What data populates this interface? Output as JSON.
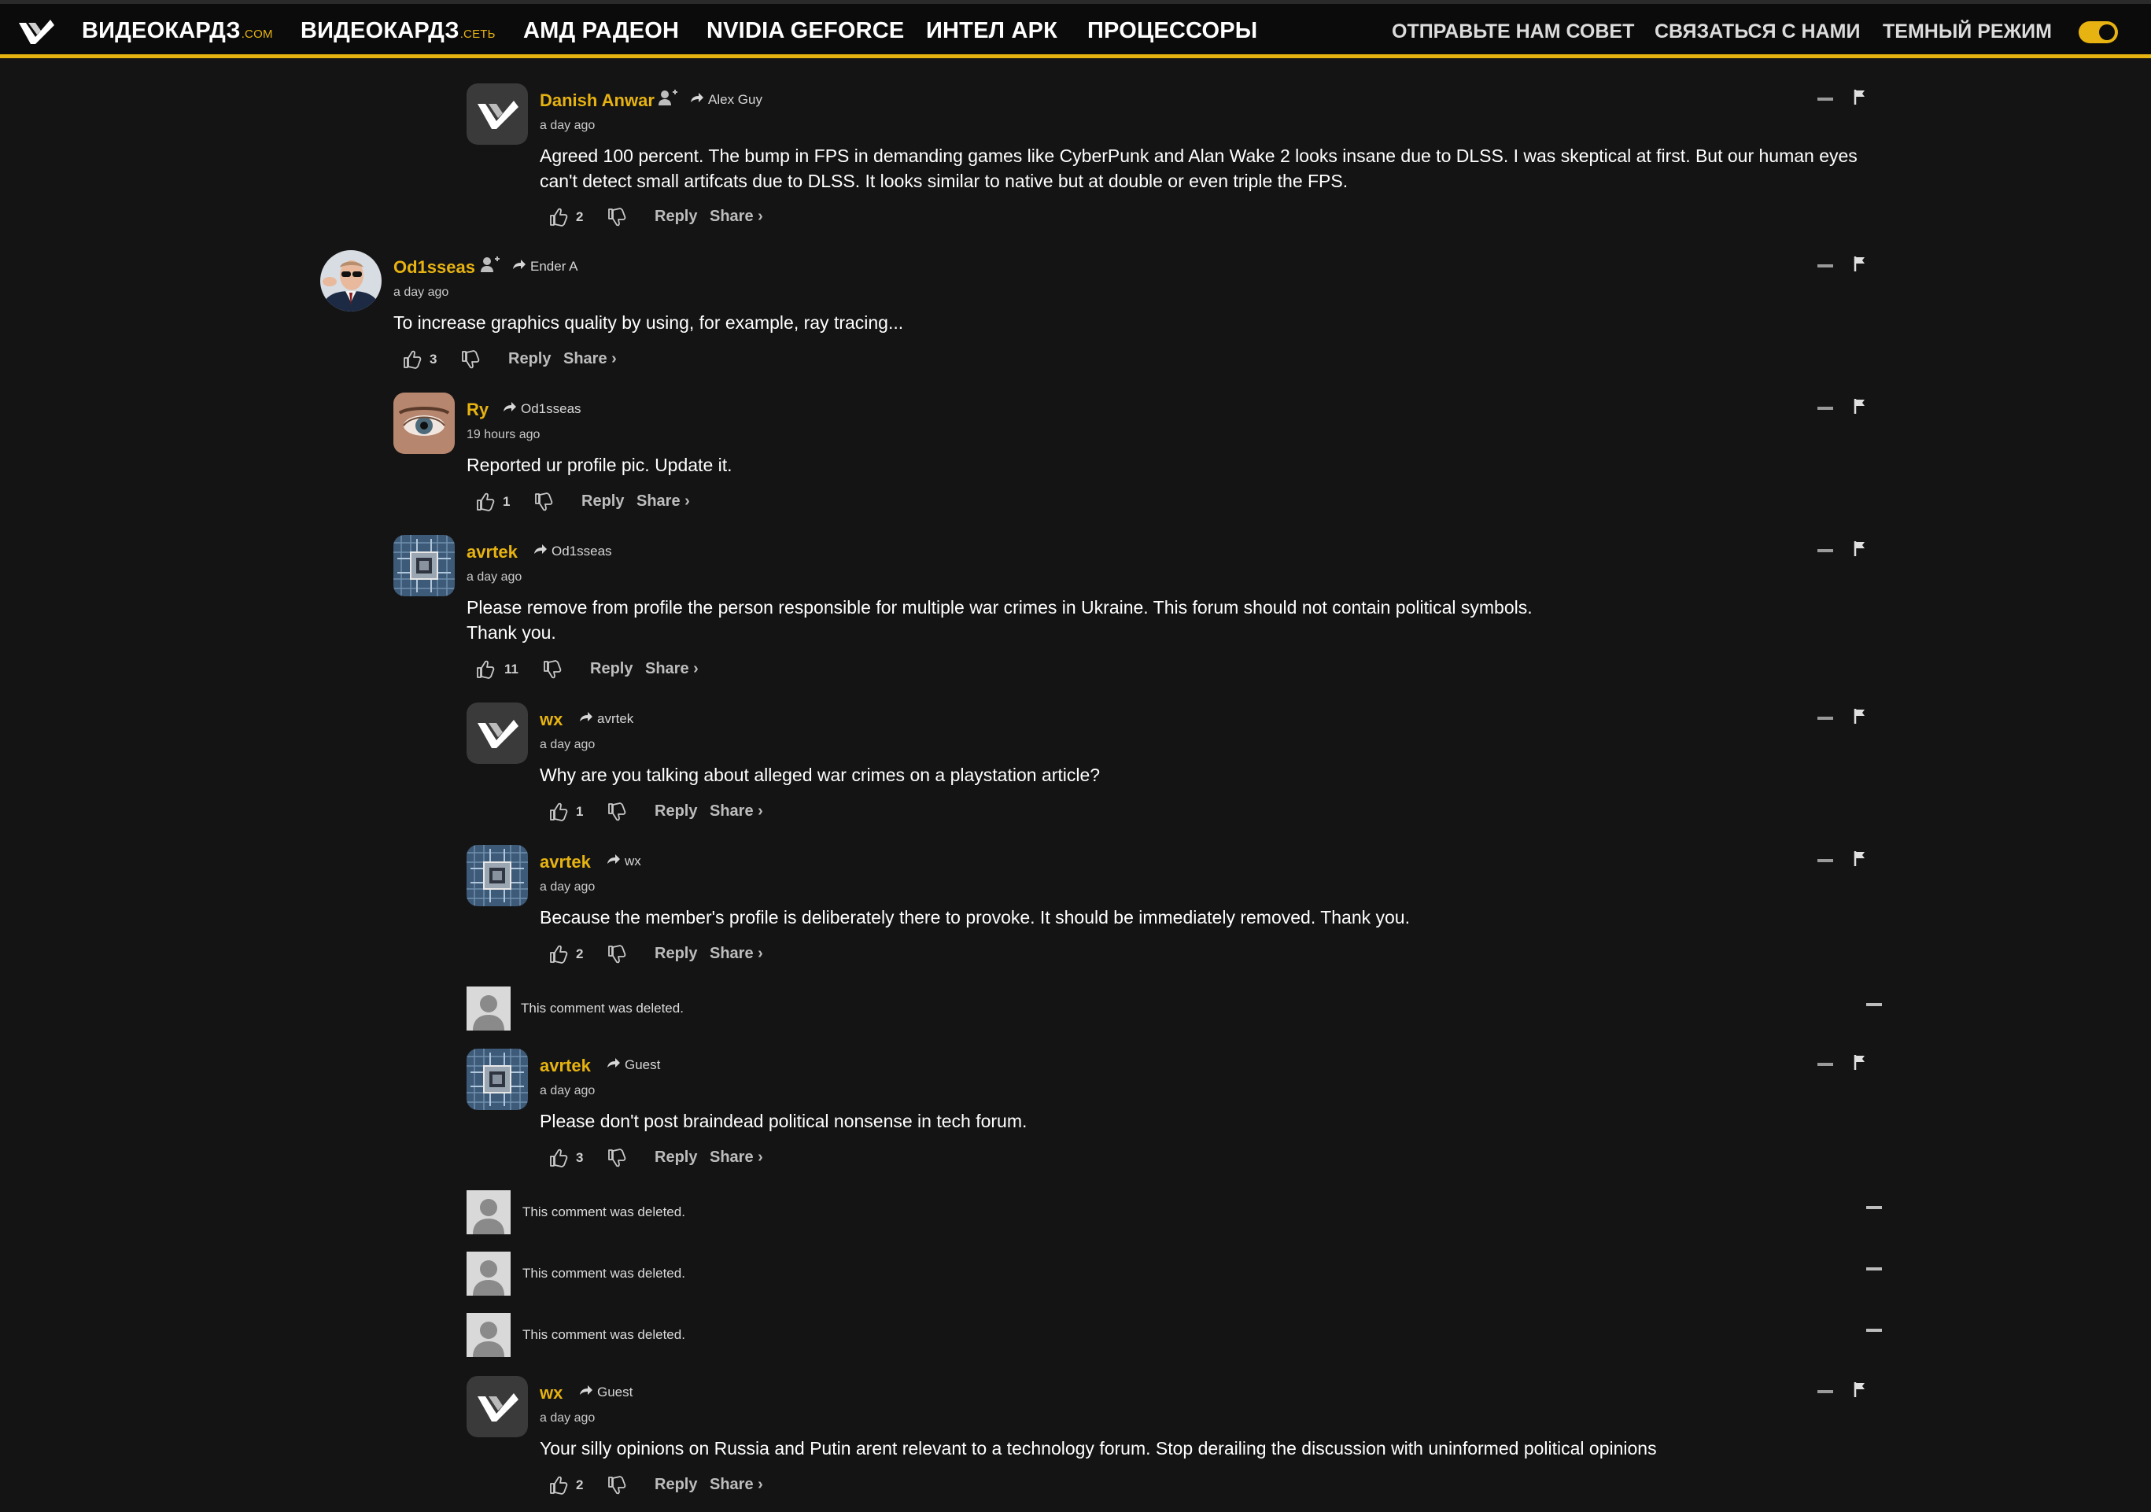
{
  "nav": {
    "site1": "ВИДЕОКАРДЗ",
    "site1_suffix": ".COM",
    "site2": "ВИДЕОКАРДЗ",
    "site2_suffix": ".СЕТЬ",
    "amd": "АМД РАДЕОН",
    "nvidia": "NVIDIA GEFORCE",
    "intel": "ИНТЕЛ АРК",
    "cpu": "ПРОЦЕССОРЫ",
    "tip": "ОТПРАВЬТЕ НАМ СОВЕТ",
    "contact": "СВЯЗАТЬСЯ С НАМИ",
    "dark": "ТЕМНЫЙ РЕЖИМ",
    "dark_mode_on": true,
    "accent": "#e7b311"
  },
  "labels": {
    "reply": "Reply",
    "share": "Share ›",
    "deleted": "This comment was deleted."
  },
  "comments": [
    {
      "author": "Danish Anwar",
      "reply_to": "Alex Guy",
      "time": "a day ago",
      "body": "Agreed 100 percent. The bump in FPS in demanding games like CyberPunk and Alan Wake 2 looks insane due to DLSS. I was skeptical at first. But our human eyes can't detect small artifcats due to DLSS. It looks similar to native but at double or even triple the FPS.",
      "likes": "2",
      "avatar": "vc-logo"
    },
    {
      "author": "Od1sseas",
      "reply_to": "Ender A",
      "time": "a day ago",
      "body": "To increase graphics quality by using, for example, ray tracing...",
      "likes": "3",
      "avatar": "photo-man"
    },
    {
      "author": "Ry",
      "reply_to": "Od1sseas",
      "time": "19 hours ago",
      "body": "Reported ur profile pic. Update it.",
      "likes": "1",
      "avatar": "photo-eye"
    },
    {
      "author": "avrtek",
      "reply_to": "Od1sseas",
      "time": "a day ago",
      "body": "Please remove from profile the person responsible for multiple war crimes in Ukraine. This forum should not contain political symbols.",
      "body2": "Thank you.",
      "likes": "11",
      "avatar": "chip"
    },
    {
      "author": "wx",
      "reply_to": "avrtek",
      "time": "a day ago",
      "body": "Why are you talking about alleged war crimes on a playstation article?",
      "likes": "1",
      "avatar": "vc-logo"
    },
    {
      "author": "avrtek",
      "reply_to": "wx",
      "time": "a day ago",
      "body": "Because the member's profile is deliberately there to provoke. It should be immediately removed. Thank you.",
      "likes": "2",
      "avatar": "chip"
    },
    {
      "author": "avrtek",
      "reply_to": "Guest",
      "time": "a day ago",
      "body": "Please don't post braindead political nonsense in tech forum.",
      "likes": "3",
      "avatar": "chip"
    },
    {
      "author": "wx",
      "reply_to": "Guest",
      "time": "a day ago",
      "body": "Your silly opinions on Russia and Putin arent relevant to a technology forum. Stop derailing the discussion with uninformed political opinions",
      "likes": "2",
      "avatar": "vc-logo"
    }
  ]
}
